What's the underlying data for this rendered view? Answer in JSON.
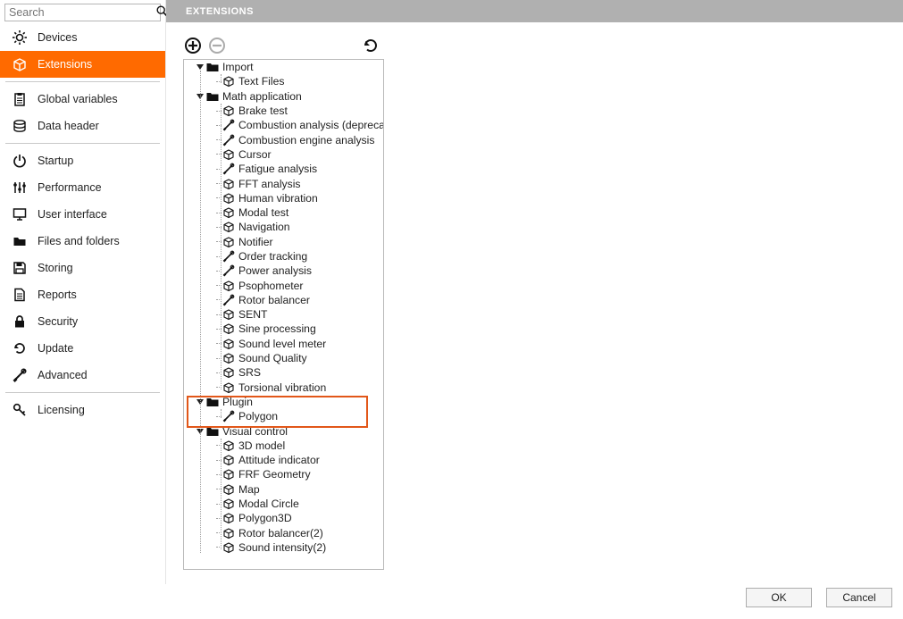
{
  "search": {
    "placeholder": "Search"
  },
  "sidebar": {
    "groups": [
      [
        {
          "key": "devices",
          "label": "Devices",
          "icon": "gear"
        },
        {
          "key": "extensions",
          "label": "Extensions",
          "icon": "cube-open",
          "selected": true
        }
      ],
      [
        {
          "key": "global-variables",
          "label": "Global variables",
          "icon": "clipboard"
        },
        {
          "key": "data-header",
          "label": "Data header",
          "icon": "disks"
        }
      ],
      [
        {
          "key": "startup",
          "label": "Startup",
          "icon": "power"
        },
        {
          "key": "performance",
          "label": "Performance",
          "icon": "sliders"
        },
        {
          "key": "user-interface",
          "label": "User interface",
          "icon": "monitor"
        },
        {
          "key": "files-and-folders",
          "label": "Files and folders",
          "icon": "folder"
        },
        {
          "key": "storing",
          "label": "Storing",
          "icon": "floppy"
        },
        {
          "key": "reports",
          "label": "Reports",
          "icon": "paper"
        },
        {
          "key": "security",
          "label": "Security",
          "icon": "lock"
        },
        {
          "key": "update",
          "label": "Update",
          "icon": "refresh"
        },
        {
          "key": "advanced",
          "label": "Advanced",
          "icon": "tools"
        }
      ],
      [
        {
          "key": "licensing",
          "label": "Licensing",
          "icon": "key"
        }
      ]
    ]
  },
  "header": {
    "title": "EXTENSIONS"
  },
  "toolbar": {
    "add": "Add",
    "remove": "Remove",
    "refresh": "Refresh"
  },
  "tree": [
    {
      "label": "Import",
      "icon": "folder",
      "expanded": true,
      "children": [
        {
          "label": "Text Files",
          "icon": "cube"
        }
      ]
    },
    {
      "label": "Math application",
      "icon": "folder",
      "expanded": true,
      "children": [
        {
          "label": "Brake test",
          "icon": "cube"
        },
        {
          "label": "Combustion analysis (deprecated)",
          "icon": "tools"
        },
        {
          "label": "Combustion engine analysis",
          "icon": "tools"
        },
        {
          "label": "Cursor",
          "icon": "cube"
        },
        {
          "label": "Fatigue analysis",
          "icon": "tools"
        },
        {
          "label": "FFT analysis",
          "icon": "cube"
        },
        {
          "label": "Human vibration",
          "icon": "cube"
        },
        {
          "label": "Modal test",
          "icon": "cube"
        },
        {
          "label": "Navigation",
          "icon": "cube"
        },
        {
          "label": "Notifier",
          "icon": "cube"
        },
        {
          "label": "Order tracking",
          "icon": "tools"
        },
        {
          "label": "Power analysis",
          "icon": "tools"
        },
        {
          "label": "Psophometer",
          "icon": "cube"
        },
        {
          "label": "Rotor balancer",
          "icon": "tools"
        },
        {
          "label": "SENT",
          "icon": "cube"
        },
        {
          "label": "Sine processing",
          "icon": "cube"
        },
        {
          "label": "Sound level meter",
          "icon": "cube"
        },
        {
          "label": "Sound Quality",
          "icon": "cube"
        },
        {
          "label": "SRS",
          "icon": "cube"
        },
        {
          "label": "Torsional vibration",
          "icon": "cube"
        }
      ]
    },
    {
      "label": "Plugin",
      "icon": "folder",
      "expanded": true,
      "highlight": true,
      "children": [
        {
          "label": "Polygon",
          "icon": "tools"
        }
      ]
    },
    {
      "label": "Visual control",
      "icon": "folder",
      "expanded": true,
      "children": [
        {
          "label": "3D model",
          "icon": "cube"
        },
        {
          "label": "Attitude indicator",
          "icon": "cube"
        },
        {
          "label": "FRF Geometry",
          "icon": "cube"
        },
        {
          "label": "Map",
          "icon": "cube"
        },
        {
          "label": "Modal Circle",
          "icon": "cube"
        },
        {
          "label": "Polygon3D",
          "icon": "cube"
        },
        {
          "label": "Rotor balancer(2)",
          "icon": "cube"
        },
        {
          "label": "Sound intensity(2)",
          "icon": "cube"
        }
      ]
    }
  ],
  "footer": {
    "ok": "OK",
    "cancel": "Cancel"
  }
}
